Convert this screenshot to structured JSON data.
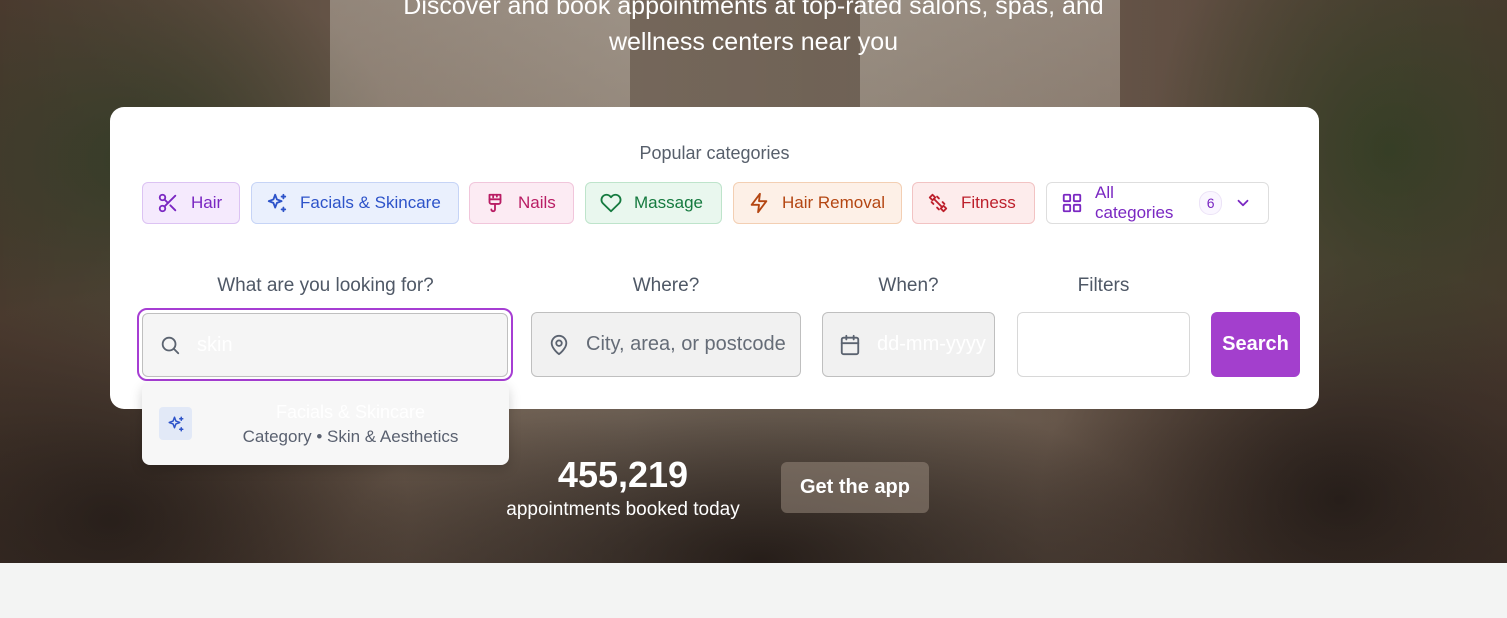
{
  "hero": {
    "tagline_line1": "Discover and book appointments at top-rated salons, spas, and",
    "tagline_line2": "wellness centers near you"
  },
  "categories": {
    "title": "Popular categories",
    "items": [
      {
        "label": "Hair",
        "icon": "scissors-icon"
      },
      {
        "label": "Facials & Skincare",
        "icon": "sparkles-icon"
      },
      {
        "label": "Nails",
        "icon": "brush-icon"
      },
      {
        "label": "Massage",
        "icon": "heart-icon"
      },
      {
        "label": "Hair Removal",
        "icon": "zap-icon"
      },
      {
        "label": "Fitness",
        "icon": "dumbbell-icon"
      }
    ],
    "all_label": "All categories",
    "all_count": "6"
  },
  "search": {
    "what_label": "What are you looking for?",
    "what_value": "skin",
    "where_label": "Where?",
    "where_placeholder": "City, area, or postcode",
    "when_label": "When?",
    "when_placeholder": "dd-mm-yyyy",
    "filters_label": "Filters",
    "button_label": "Search"
  },
  "suggestions": [
    {
      "title": "Facials & Skincare",
      "subtitle": "Category • Skin & Aesthetics",
      "icon": "sparkles-icon"
    }
  ],
  "stats": {
    "number": "455,219",
    "label": "appointments booked today"
  },
  "app_button": "Get the app",
  "colors": {
    "accent": "#a33fcd",
    "focus_border": "#a63ed3"
  }
}
